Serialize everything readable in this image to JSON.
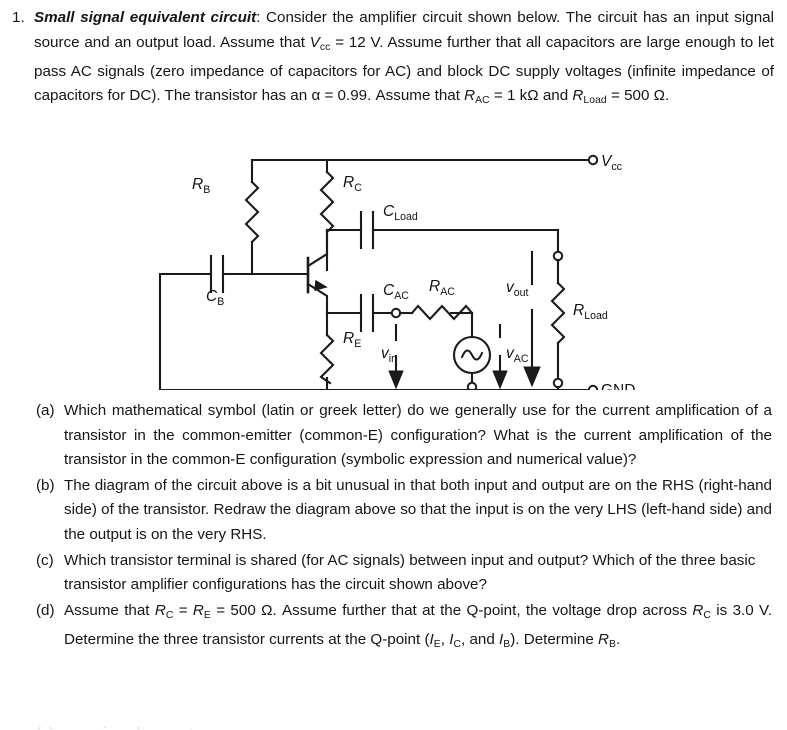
{
  "problem": {
    "number": "1.",
    "lead": "Small signal equivalent circuit",
    "colon": ":",
    "text_part1": " Consider the amplifier circuit shown below. The circuit has an input signal source and an output load.  Assume that ",
    "vcc_symbol": "V",
    "vcc_sub": "cc",
    "text_part2": " = 12 V. Assume further that all capacitors are large enough to let pass AC signals (zero impedance of capacitors for AC) and block DC supply voltages (infinite impedance of capacitors for DC). The transistor has an ",
    "alpha": "α",
    "text_part3": " = 0.99. Assume that ",
    "rac_symbol": "R",
    "rac_sub": "AC",
    "text_part4": " = 1 k",
    "ohm1": "Ω",
    "text_part5": " and ",
    "rload_symbol": "R",
    "rload_sub": "Load",
    "text_part6": " = 500 ",
    "ohm2": "Ω",
    "text_part7": "."
  },
  "subquestions": [
    {
      "label": "(a)",
      "text": "Which mathematical symbol (latin or greek letter) do we generally use for the current amplification of a transistor in the common-emitter (common-E) configuration? What is the current amplification of the transistor in the common-E configuration (symbolic expression and numerical value)?"
    },
    {
      "label": "(b)",
      "text": "The diagram of the circuit above is a bit unusual in that both input and output are on the RHS (right-hand side) of the transistor. Redraw the diagram above so that the input is on the very LHS (left-hand side) and the output is on the very RHS."
    },
    {
      "label": "(c)",
      "text": "Which transistor terminal is shared (for AC signals) between input and output? Which of the three basic transistor amplifier configurations has the circuit shown above?"
    }
  ],
  "subquestion_d": {
    "label": "(d)",
    "p1": "Assume that ",
    "rc_symbol": "R",
    "rc_sub": "C",
    "p2": " = ",
    "re_symbol": "R",
    "re_sub": "E",
    "p3": " = 500 ",
    "ohm": "Ω",
    "p4": ". Assume further that at the Q-point, the voltage drop across ",
    "rc2_symbol": "R",
    "rc2_sub": "C",
    "p5": " is 3.0 V. Determine the three transistor currents at the Q-point (",
    "ie_symbol": "I",
    "ie_sub": "E",
    "p6": ", ",
    "ic_symbol": "I",
    "ic_sub": "C",
    "p7": ", and ",
    "ib_symbol": "I",
    "ib_sub": "B",
    "p8": "). Determine ",
    "rb_symbol": "R",
    "rb_sub": "B",
    "p9": "."
  },
  "figure": {
    "title": "amplifier-circuit-diagram",
    "stroke_color": "#1a1a1a",
    "labels": {
      "rb": {
        "main": "R",
        "sub": "B"
      },
      "rc": {
        "main": "R",
        "sub": "C"
      },
      "re": {
        "main": "R",
        "sub": "E"
      },
      "rac": {
        "main": "R",
        "sub": "AC"
      },
      "rload": {
        "main": "R",
        "sub": "Load"
      },
      "cb": {
        "main": "C",
        "sub": "B"
      },
      "cload": {
        "main": "C",
        "sub": "Load"
      },
      "cac": {
        "main": "C",
        "sub": "AC"
      },
      "vin": {
        "main": "v",
        "sub": "in"
      },
      "vout": {
        "main": "v",
        "sub": "out"
      },
      "vac": {
        "main": "v",
        "sub": "AC"
      },
      "vcc": {
        "main": "V",
        "sub": "cc"
      },
      "gnd": {
        "main": "GND",
        "sub": ""
      }
    }
  },
  "cutoff_line": "(e) ... continued on next page ..."
}
